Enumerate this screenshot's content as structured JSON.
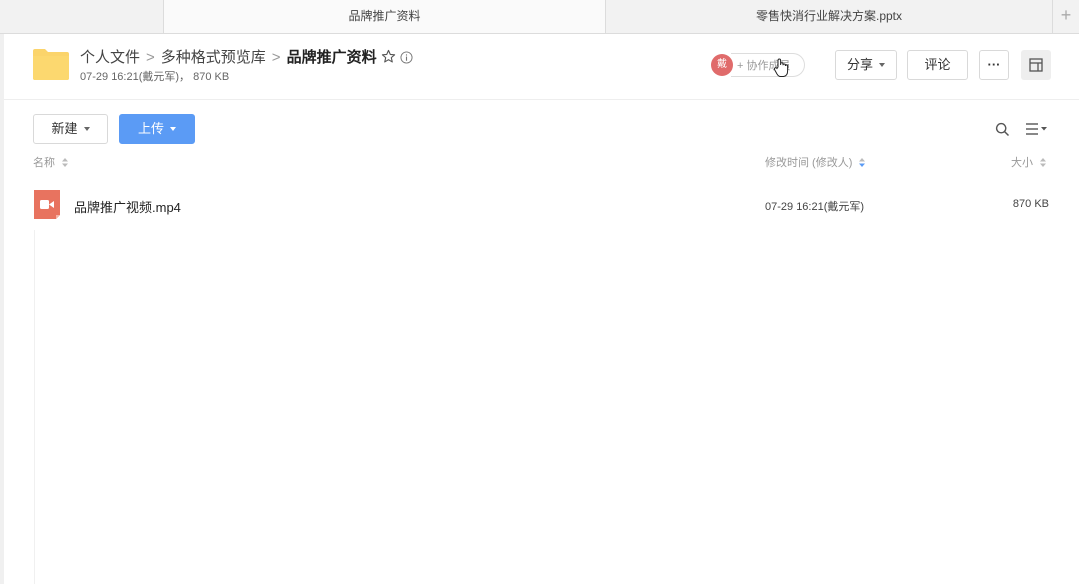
{
  "tabs": [
    {
      "label": "品牌推广资料"
    },
    {
      "label": "零售快消行业解决方案.pptx"
    }
  ],
  "tab_add": "+",
  "breadcrumb": {
    "items": [
      "个人文件",
      "多种格式预览库"
    ],
    "current": "品牌推广资料",
    "separator": ">"
  },
  "meta": "07-29 16:21(戴元军)，  870 KB",
  "header": {
    "avatar_text": "戴",
    "collab_label": "+ 协作成员",
    "share_label": "分享",
    "comment_label": "评论",
    "more_label": "···"
  },
  "toolbar": {
    "new_label": "新建",
    "upload_label": "上传"
  },
  "columns": {
    "name": "名称",
    "modified": "修改时间 (修改人)",
    "size": "大小"
  },
  "files": [
    {
      "name": "品牌推广视频.mp4",
      "modified": "07-29 16:21(戴元军)",
      "size": "870 KB",
      "type": "video"
    }
  ],
  "colors": {
    "accent": "#5b9bf5",
    "folder": "#fbd46b",
    "video_icon": "#e8735f",
    "avatar": "#e06b6b"
  }
}
